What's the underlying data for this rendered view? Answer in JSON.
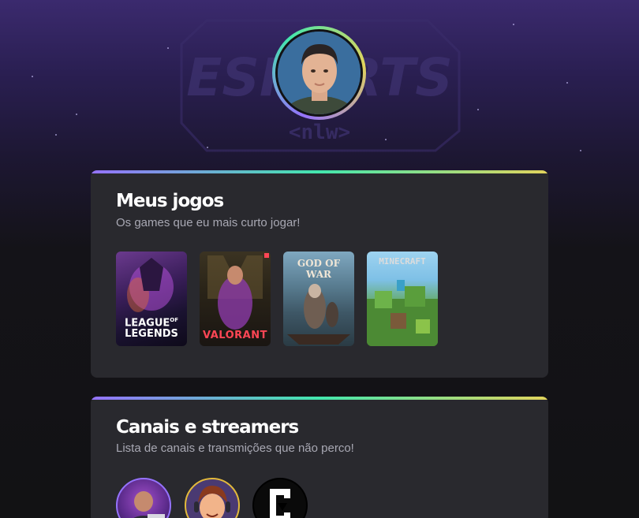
{
  "background": {
    "logo_text_top": "ESPORTS",
    "logo_text_bottom": "<nlw>"
  },
  "profile": {
    "avatar_alt": "profile photo"
  },
  "games_section": {
    "title": "Meus jogos",
    "subtitle": "Os games que eu mais curto jogar!",
    "games": [
      {
        "name": "LEAGUE OF LEGENDS",
        "line1": "LEAGUE",
        "of": "OF",
        "line2": "LEGENDS",
        "accent": "#c39b4a"
      },
      {
        "name": "VALORANT",
        "label": "VALORANT",
        "accent": "#ff4655"
      },
      {
        "name": "GOD OF WAR",
        "label": "GOD OF WAR",
        "accent": "#c0392b"
      },
      {
        "name": "MINECRAFT",
        "label": "MINECRAFT",
        "accent": "#5b8c32"
      }
    ]
  },
  "channels_section": {
    "title": "Canais e streamers",
    "subtitle": "Lista de canais e transmições que não perco!",
    "channels": [
      {
        "name": "channel-1",
        "ring": "#9572fc"
      },
      {
        "name": "channel-2",
        "ring": "#e2b93b"
      },
      {
        "name": "channel-3",
        "ring": "#000000"
      }
    ]
  },
  "colors": {
    "background": "#121214",
    "card": "#29292e",
    "gradient": [
      "#9572fc",
      "#43e7ad",
      "#e2d45c"
    ],
    "title": "#ffffff",
    "subtitle": "#a8a8b3"
  }
}
